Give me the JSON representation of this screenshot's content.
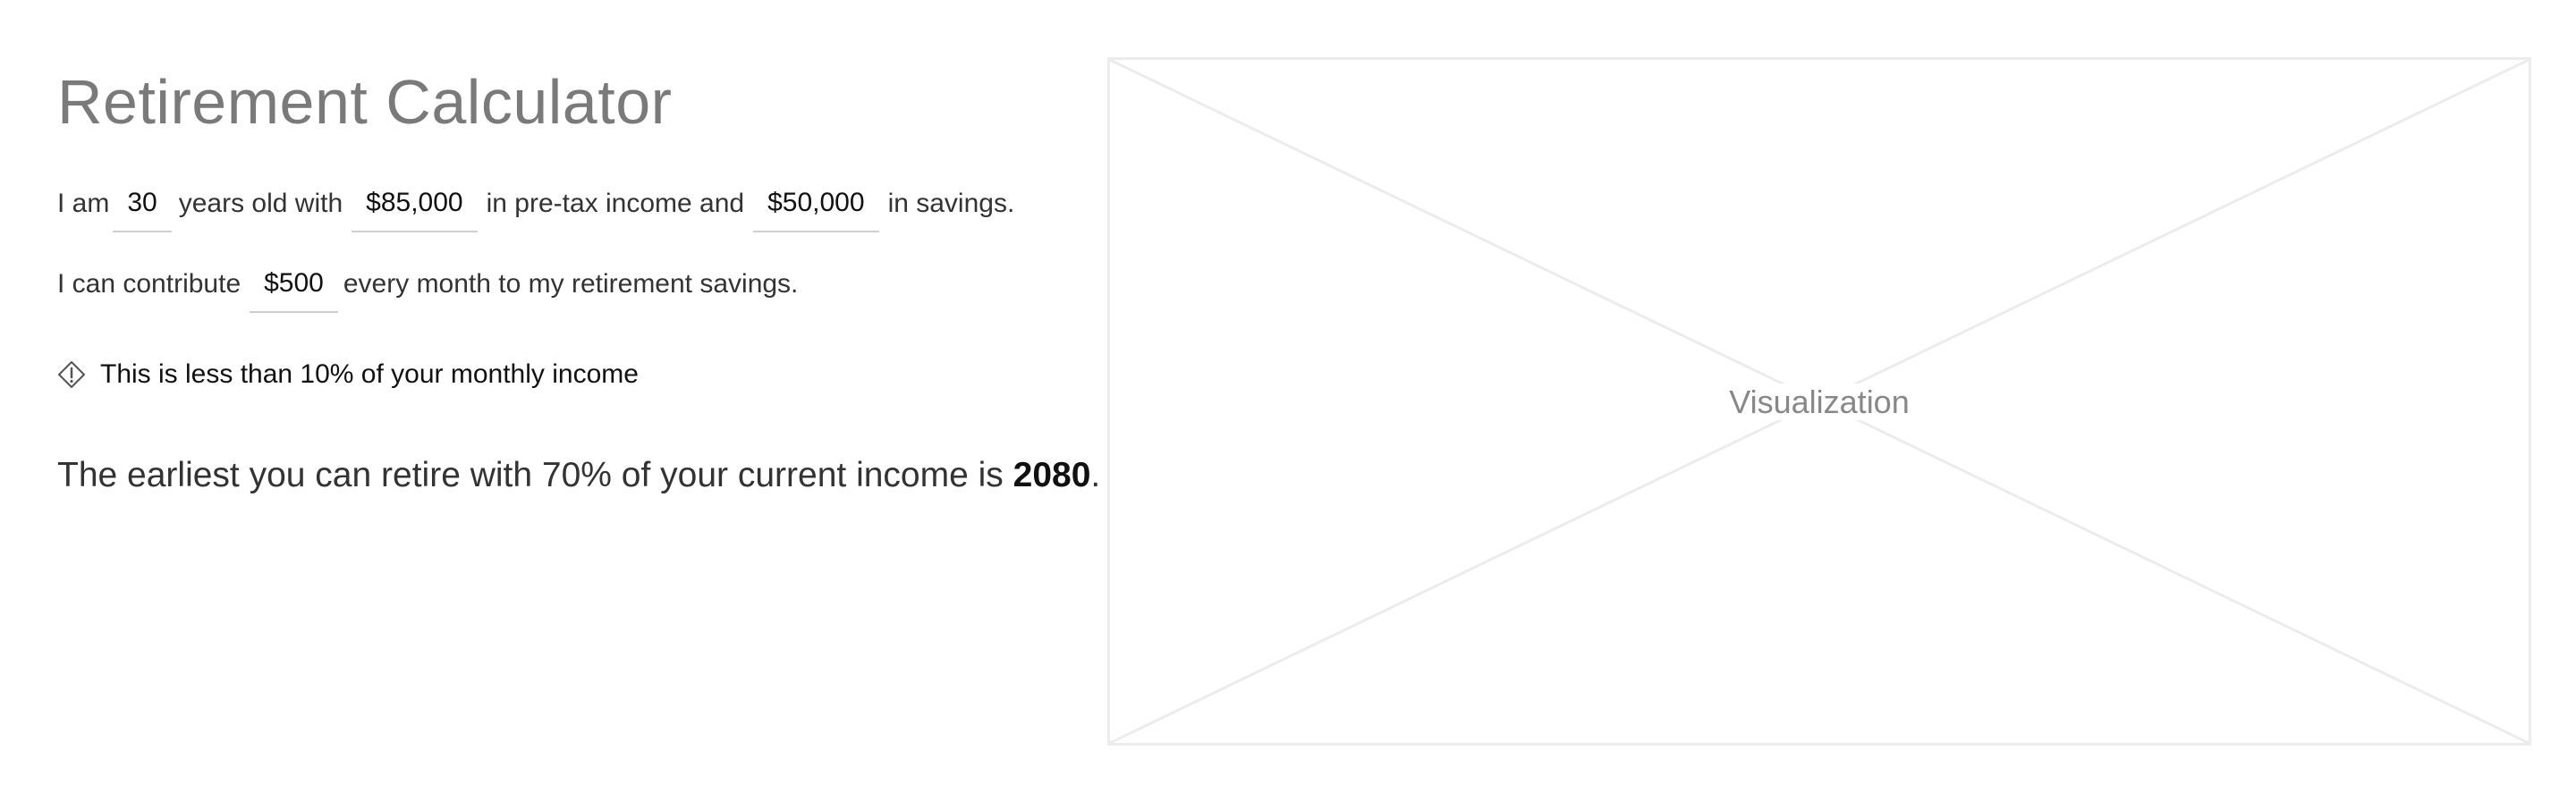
{
  "header": {
    "title": "Retirement Calculator"
  },
  "form": {
    "sentence1": {
      "prefix": "I am",
      "age_value": "30",
      "mid1": "years old with",
      "income_value": "$85,000",
      "mid2": "in pre-tax income and",
      "savings_value": "$50,000",
      "suffix": "in savings."
    },
    "sentence2": {
      "prefix": "I can contribute",
      "contribution_value": "$500",
      "suffix": "every month to my retirement savings."
    }
  },
  "warning": {
    "icon": "warning-diamond-icon",
    "text": "This is less than 10% of your monthly income"
  },
  "result": {
    "prefix": "The earliest you can retire with 70% of your current income is",
    "year": "2080",
    "suffix": "."
  },
  "visualization": {
    "label": "Visualization"
  }
}
